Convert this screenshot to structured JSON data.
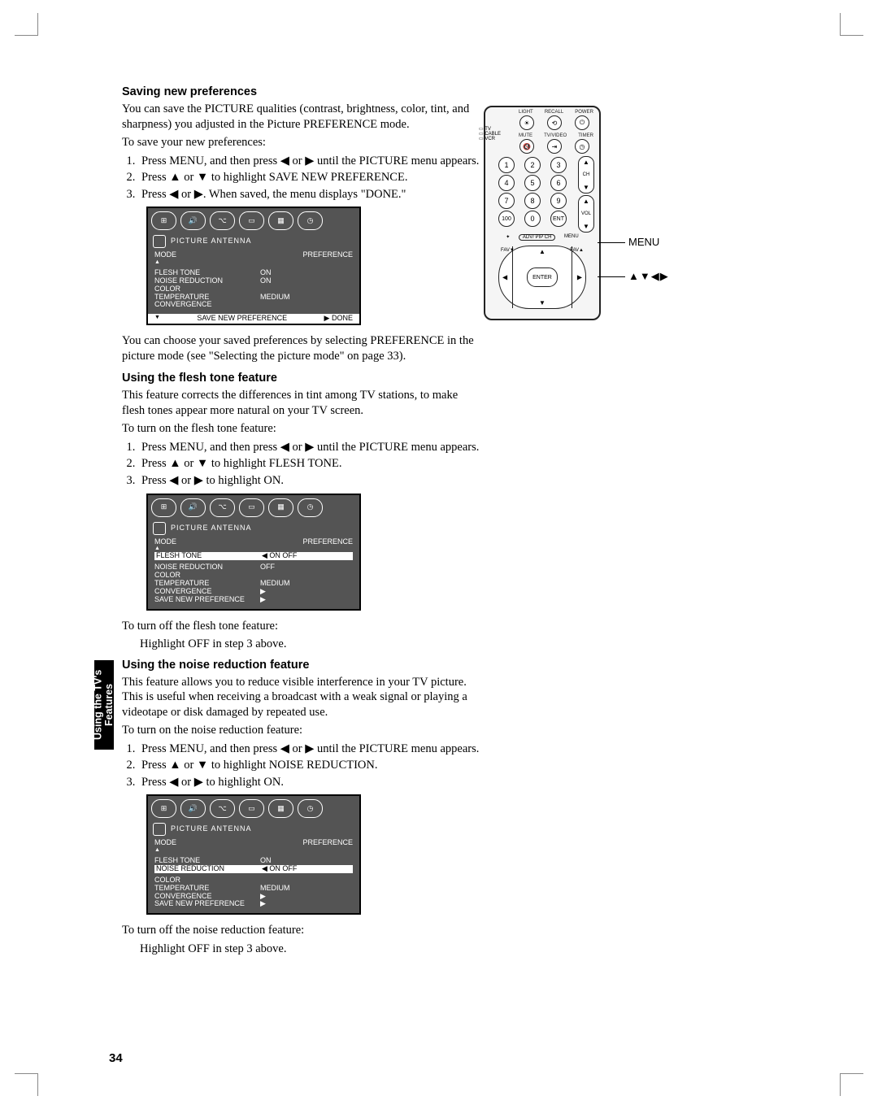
{
  "sidebar": {
    "chapter": "Using the TV's Features"
  },
  "page_number": "34",
  "remote": {
    "labels_row1": [
      "LIGHT",
      "RECALL",
      "POWER"
    ],
    "labels_row2": [
      "MUTE",
      "TV/VIDEO",
      "TIMER"
    ],
    "switch_labels": [
      "TV",
      "CABLE",
      "VCR"
    ],
    "num": [
      "1",
      "2",
      "3",
      "4",
      "5",
      "6",
      "7",
      "8",
      "9",
      "100",
      "0",
      "ENT"
    ],
    "ch": "CH",
    "vol": "VOL",
    "enter": "ENTER",
    "pipch": "ADV/\nPIP CH",
    "fav": "FAV",
    "callout_menu": "MENU",
    "callout_arrows": "▲▼◀▶"
  },
  "sections": [
    {
      "title": "Saving new preferences",
      "intro": [
        "You can save the PICTURE qualities (contrast, brightness, color, tint, and sharpness) you adjusted in the Picture PREFERENCE mode.",
        "To save your new preferences:"
      ],
      "steps": [
        "Press MENU, and then press ◀ or ▶ until the PICTURE menu appears.",
        "Press ▲ or ▼ to highlight SAVE NEW PREFERENCE.",
        "Press ◀ or ▶. When saved, the menu displays \"DONE.\""
      ],
      "osd": {
        "header": "PICTURE  ANTENNA",
        "mode_left": "MODE",
        "mode_right": "PREFERENCE",
        "rows": [
          {
            "lbl": "FLESH  TONE",
            "val": "ON"
          },
          {
            "lbl": "NOISE  REDUCTION",
            "val": "ON"
          },
          {
            "lbl": "COLOR",
            "val": ""
          },
          {
            "lbl": " TEMPERATURE",
            "val": "MEDIUM"
          },
          {
            "lbl": "CONVERGENCE",
            "val": ""
          }
        ],
        "hl_row": {
          "lbl": "SAVE  NEW    PREFERENCE",
          "val": "▶  DONE"
        }
      },
      "after": [
        "You can choose your saved preferences by selecting PREFERENCE in the picture mode (see \"Selecting the picture mode\" on page 33)."
      ]
    },
    {
      "title": "Using the flesh tone feature",
      "intro": [
        "This feature corrects the differences in tint among TV stations, to make flesh tones appear more natural on your TV screen.",
        "To turn on the flesh tone feature:"
      ],
      "steps": [
        "Press MENU, and then press ◀ or ▶ until the PICTURE menu appears.",
        "Press ▲ or ▼ to highlight FLESH TONE.",
        "Press ◀ or ▶ to highlight ON."
      ],
      "osd": {
        "header": "PICTURE  ANTENNA",
        "mode_left": "MODE",
        "mode_right": "PREFERENCE",
        "hl_row": {
          "lbl": "FLESH  TONE",
          "val": "◀ ON OFF"
        },
        "rows": [
          {
            "lbl": "NOISE  REDUCTION",
            "val": "OFF"
          },
          {
            "lbl": "COLOR",
            "val": ""
          },
          {
            "lbl": " TEMPERATURE",
            "val": "MEDIUM"
          },
          {
            "lbl": "CONVERGENCE",
            "val": "▶"
          },
          {
            "lbl": "SAVE  NEW  PREFERENCE",
            "val": "▶"
          }
        ]
      },
      "after_label": "To turn off the flesh tone feature:",
      "after_indent": "Highlight OFF in step 3 above."
    },
    {
      "title": "Using the noise reduction feature",
      "intro": [
        "This feature allows you to reduce visible interference in your TV picture. This is useful when receiving a broadcast with a weak signal or playing a videotape or disk damaged by repeated use.",
        "To turn on the noise reduction feature:"
      ],
      "steps": [
        "Press MENU, and then press ◀ or ▶ until the PICTURE menu appears.",
        "Press ▲ or ▼ to highlight NOISE REDUCTION.",
        "Press ◀ or ▶ to highlight ON."
      ],
      "osd": {
        "header": "PICTURE  ANTENNA",
        "mode_left": "MODE",
        "mode_right": "PREFERENCE",
        "rows_before": [
          {
            "lbl": "FLESH  TONE",
            "val": "ON"
          }
        ],
        "hl_row": {
          "lbl": "NOISE  REDUCTION",
          "val": "◀ ON OFF"
        },
        "rows": [
          {
            "lbl": "COLOR",
            "val": ""
          },
          {
            "lbl": " TEMPERATURE",
            "val": "MEDIUM"
          },
          {
            "lbl": "CONVERGENCE",
            "val": "▶"
          },
          {
            "lbl": "SAVE  NEW  PREFERENCE",
            "val": "▶"
          }
        ]
      },
      "after_label": "To turn off the noise reduction feature:",
      "after_indent": "Highlight OFF in step 3 above."
    }
  ]
}
